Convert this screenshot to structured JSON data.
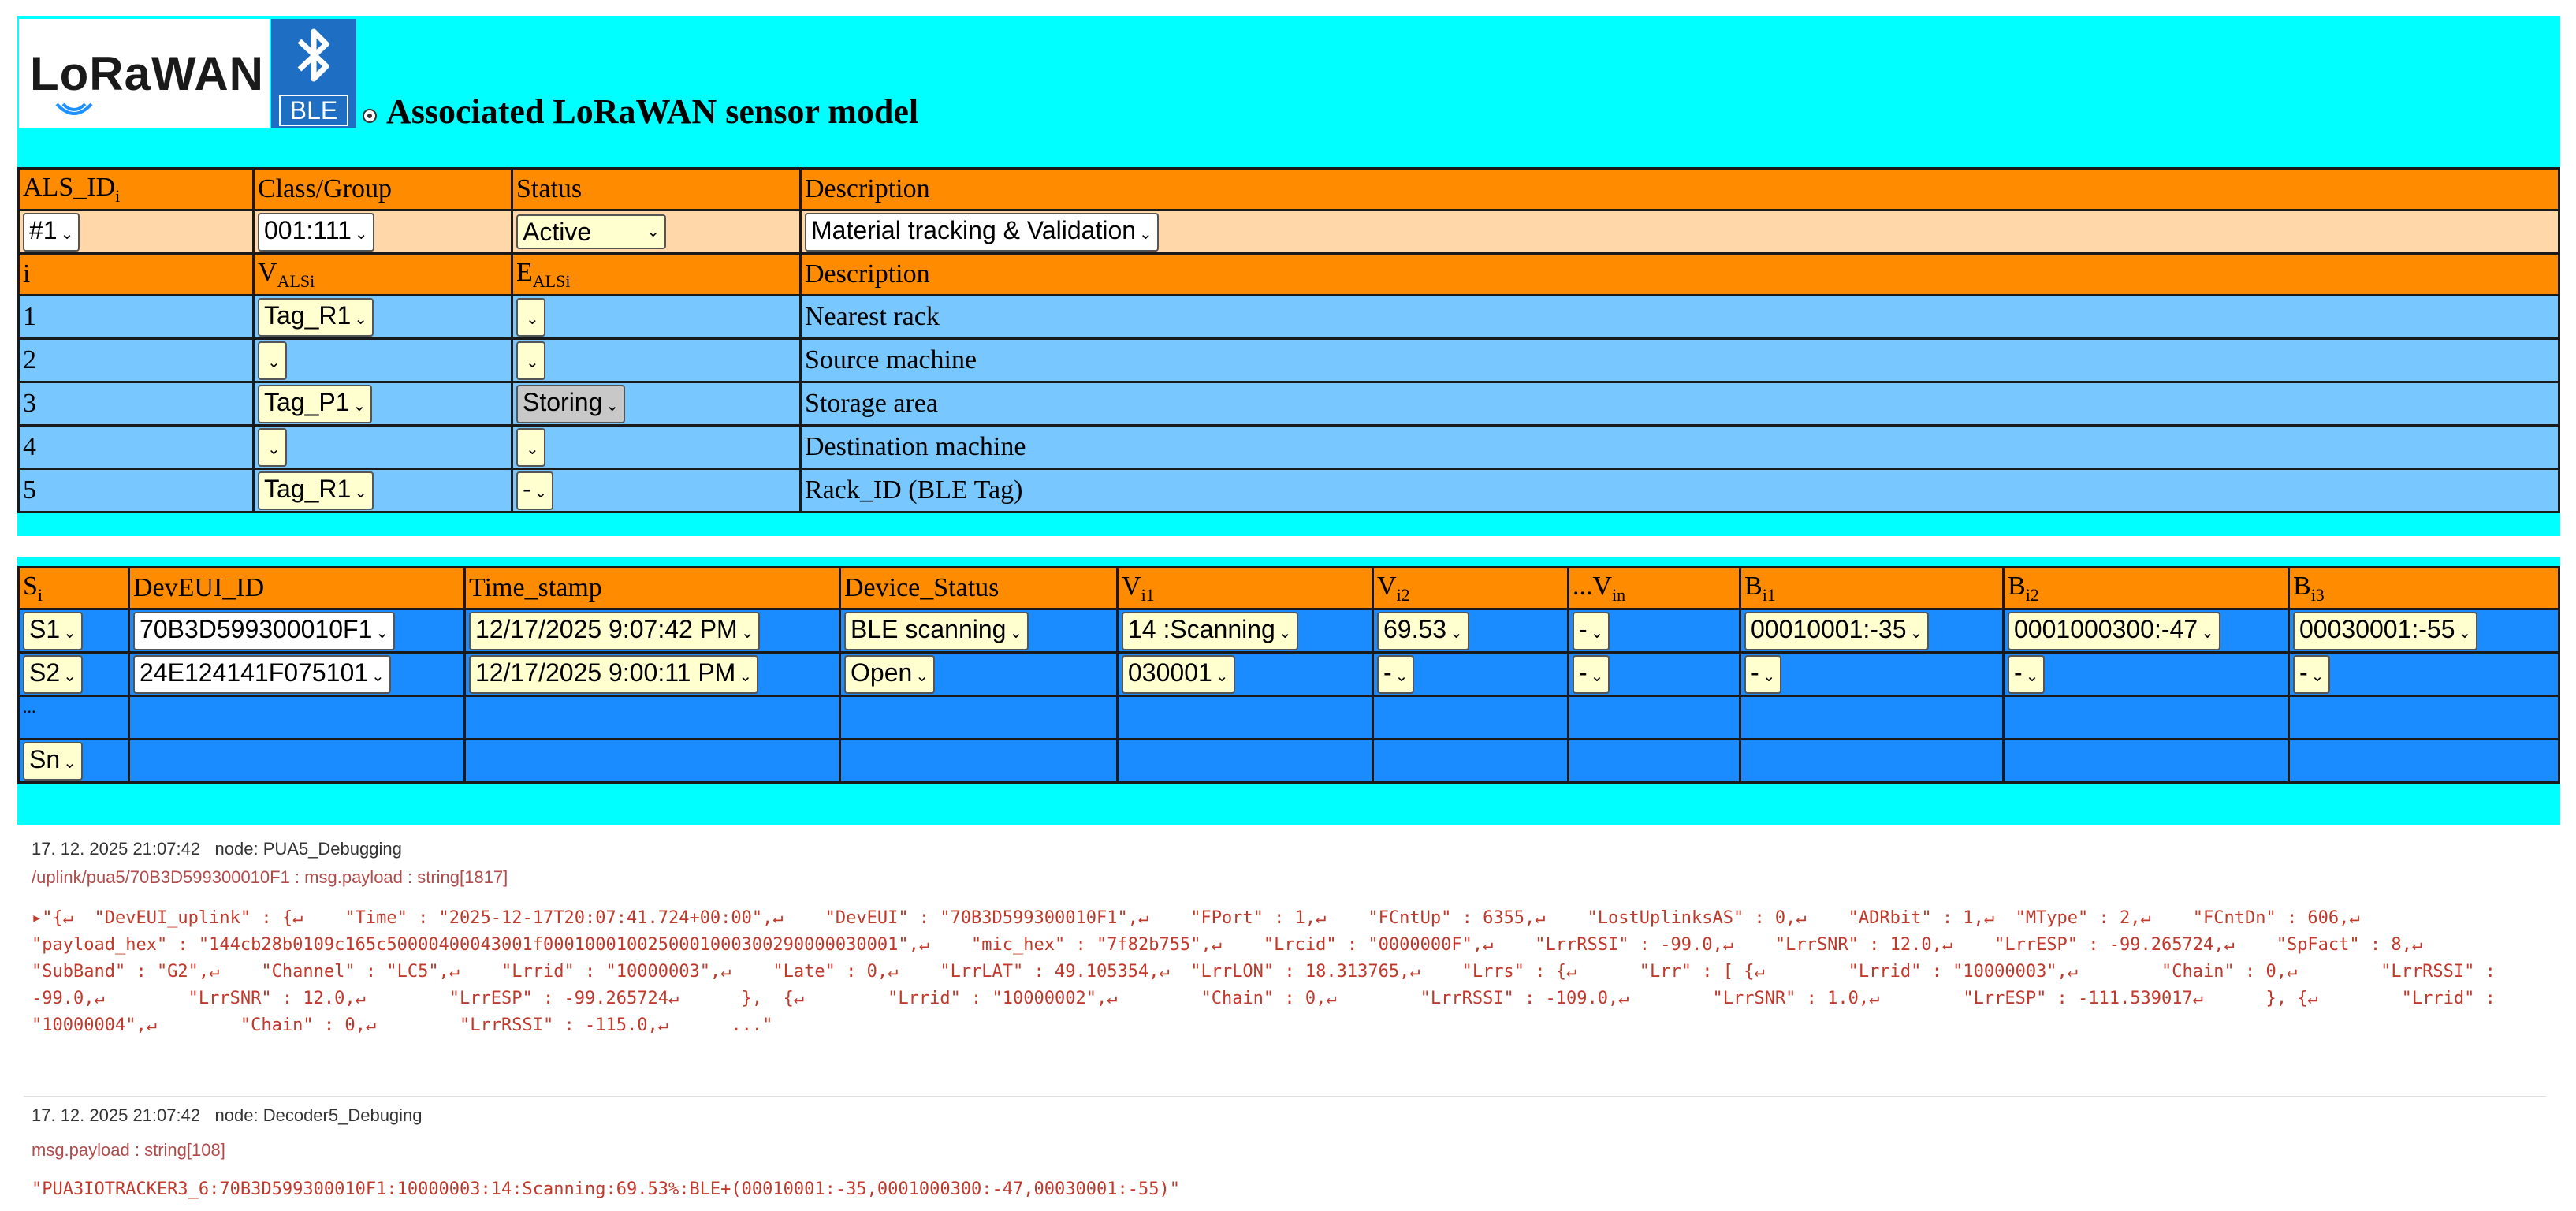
{
  "header": {
    "lorawan_logo": "LoRaWAN",
    "ble_label": "BLE",
    "title": "Associated LoRaWAN sensor model"
  },
  "model_table": {
    "header1": {
      "c1": "ALS_ID",
      "c1_sub": "i",
      "c2": "Class/Group",
      "c3": "Status",
      "c4": "Description"
    },
    "values1": {
      "id": "#1",
      "class_group": "001:111",
      "status": "Active",
      "description": "Material tracking & Validation"
    },
    "header2": {
      "c1": "i",
      "c2": "V",
      "c2_sub": "ALSi",
      "c3": "E",
      "c3_sub": "ALSi",
      "c4": "Description"
    },
    "rows": [
      {
        "i": "1",
        "v": "Tag_R1",
        "e": "",
        "desc": "Nearest rack"
      },
      {
        "i": "2",
        "v": "",
        "e": "",
        "desc": "Source machine"
      },
      {
        "i": "3",
        "v": "Tag_P1",
        "e": "Storing",
        "desc": "Storage area"
      },
      {
        "i": "4",
        "v": "",
        "e": "",
        "desc": "Destination machine"
      },
      {
        "i": "5",
        "v": "Tag_R1",
        "e": "-",
        "desc": "Rack_ID (BLE Tag)"
      }
    ]
  },
  "sensor_table": {
    "headers": {
      "s": "S",
      "s_sub": "i",
      "deveui": "DevEUI_ID",
      "time": "Time_stamp",
      "status": "Device_Status",
      "v1": "V",
      "v1_sub": "i1",
      "v2": "V",
      "v2_sub": "i2",
      "vn": "...V",
      "vn_sub": "in",
      "b1": "B",
      "b1_sub": "i1",
      "b2": "B",
      "b2_sub": "i2",
      "b3": "B",
      "b3_sub": "i3"
    },
    "rows": [
      {
        "s": "S1",
        "deveui": "70B3D599300010F1",
        "time": "12/17/2025 9:07:42 PM",
        "status": "BLE scanning",
        "v1": "14 :Scanning",
        "v2": "69.53",
        "vn": "-",
        "b1": "00010001:-35",
        "b2": "0001000300:-47",
        "b3": "00030001:-55"
      },
      {
        "s": "S2",
        "deveui": "24E124141F075101",
        "time": "12/17/2025 9:00:11 PM",
        "status": "Open",
        "v1": "030001",
        "v2": "-",
        "vn": "-",
        "b1": "-",
        "b2": "-",
        "b3": "-"
      }
    ],
    "ellipsis_row": "...",
    "last_row_s": "Sn"
  },
  "debug": {
    "msg1": {
      "timestamp": "17. 12. 2025 21:07:42",
      "node": "node: PUA5_Debugging",
      "topic": "/uplink/pua5/70B3D599300010F1 : msg.payload : string[1817]",
      "payload": "▸\"{↵  \"DevEUI_uplink\" : {↵    \"Time\" : \"2025-12-17T20:07:41.724+00:00\",↵    \"DevEUI\" : \"70B3D599300010F1\",↵    \"FPort\" : 1,↵    \"FCntUp\" : 6355,↵    \"LostUplinksAS\" : 0,↵    \"ADRbit\" : 1,↵  \"MType\" : 2,↵    \"FCntDn\" : 606,↵    \"payload_hex\" : \"144cb28b0109c165c50000400043001f0001000100250001000300290000030001\",↵    \"mic_hex\" : \"7f82b755\",↵    \"Lrcid\" : \"0000000F\",↵    \"LrrRSSI\" : -99.0,↵    \"LrrSNR\" : 12.0,↵    \"LrrESP\" : -99.265724,↵    \"SpFact\" : 8,↵    \"SubBand\" : \"G2\",↵    \"Channel\" : \"LC5\",↵    \"Lrrid\" : \"10000003\",↵    \"Late\" : 0,↵    \"LrrLAT\" : 49.105354,↵  \"LrrLON\" : 18.313765,↵    \"Lrrs\" : {↵      \"Lrr\" : [ {↵        \"Lrrid\" : \"10000003\",↵        \"Chain\" : 0,↵        \"LrrRSSI\" : -99.0,↵        \"LrrSNR\" : 12.0,↵        \"LrrESP\" : -99.265724↵      },  {↵        \"Lrrid\" : \"10000002\",↵        \"Chain\" : 0,↵        \"LrrRSSI\" : -109.0,↵        \"LrrSNR\" : 1.0,↵        \"LrrESP\" : -111.539017↵      }, {↵        \"Lrrid\" : \"10000004\",↵        \"Chain\" : 0,↵        \"LrrRSSI\" : -115.0,↵      ...\""
    },
    "msg2": {
      "timestamp": "17. 12. 2025 21:07:42",
      "node": "node: Decoder5_Debuging",
      "topic": "msg.payload : string[108]",
      "payload": "\"PUA3IOTRACKER3_6:70B3D599300010F1:10000003:14:Scanning:69.53%:BLE+(00010001:-35,0001000300:-47,00030001:-55)\""
    }
  }
}
